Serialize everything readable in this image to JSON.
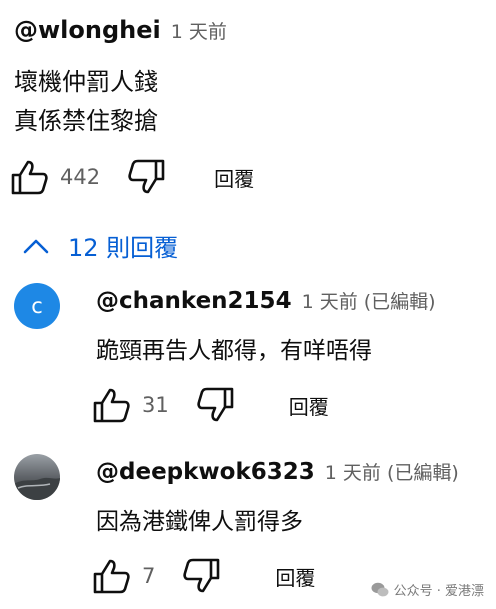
{
  "top_comment": {
    "handle": "@wlonghei",
    "time": "1 天前",
    "lines": [
      "壞機仲罰人錢",
      "真係禁住黎搶"
    ],
    "likes": "442",
    "reply_label": "回覆"
  },
  "replies_toggle": {
    "label": "12 則回覆",
    "icon": "chevron-up-icon"
  },
  "replies": [
    {
      "avatar_letter": "c",
      "avatar_color": "#1e88e5",
      "handle": "@chanken2154",
      "time": "1 天前 (已編輯)",
      "body": "跪頸再告人都得，有咩唔得",
      "likes": "31",
      "reply_label": "回覆"
    },
    {
      "avatar_letter": "",
      "handle": "@deepkwok6323",
      "time": "1 天前 (已編輯)",
      "body": "因為港鐵俾人罰得多",
      "likes": "7",
      "reply_label": "回覆"
    }
  ],
  "watermark": {
    "text": "公众号 · 爱港漂",
    "icon": "wechat-icon"
  },
  "colors": {
    "link_blue": "#065fd4",
    "text": "#0f0f0f",
    "muted": "#606060"
  }
}
